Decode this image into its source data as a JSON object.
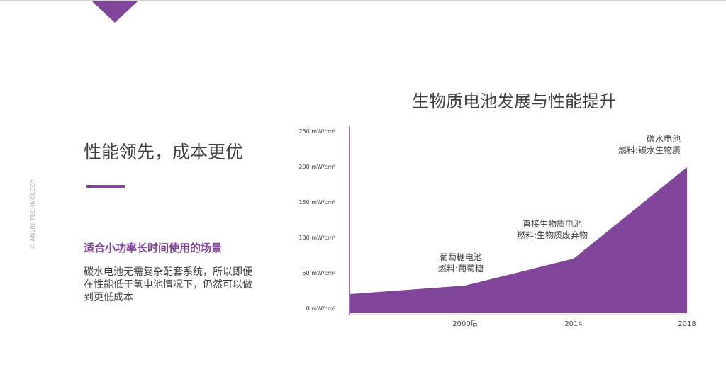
{
  "slide": {
    "accent_color": "#80449b",
    "watermark": "© ANLIU TECHNOLOGY"
  },
  "left_panel": {
    "title": "性能领先，成本更优",
    "subtitle": "适合小功率长时间使用的场景",
    "body": "碳水电池无需复杂配套系统，所以即便在性能低于氢电池情况下，仍然可以做到更低成本"
  },
  "chart_data": {
    "type": "area",
    "title": "生物质电池发展与性能提升",
    "y_unit": "mW/cm²",
    "y_ticks": [
      {
        "value": 0,
        "label": "0 mW/cm²"
      },
      {
        "value": 50,
        "label": "50 mW/cm²"
      },
      {
        "value": 100,
        "label": "100 mW/cm²"
      },
      {
        "value": 150,
        "label": "150 mW/cm²"
      },
      {
        "value": 200,
        "label": "200 mW/cm²"
      },
      {
        "value": 250,
        "label": "250 mW/cm²"
      }
    ],
    "ylim": [
      0,
      250
    ],
    "x_ticks": [
      "2000后",
      "2014",
      "2018"
    ],
    "series": [
      {
        "color": "#80449b",
        "points": [
          {
            "x": "",
            "y": 27
          },
          {
            "x": "2000后",
            "y": 39
          },
          {
            "x": "2014",
            "y": 77
          },
          {
            "x": "2018",
            "y": 206
          }
        ]
      }
    ],
    "annotations": [
      {
        "x": "2000后",
        "lines": [
          "葡萄糖电池",
          "燃料:葡萄糖"
        ]
      },
      {
        "x": "2014",
        "lines": [
          "直接生物质电池",
          "燃料:生物质废弃物"
        ]
      },
      {
        "x": "2018",
        "lines": [
          "碳水电池",
          "燃料:碳水生物质"
        ]
      }
    ]
  }
}
